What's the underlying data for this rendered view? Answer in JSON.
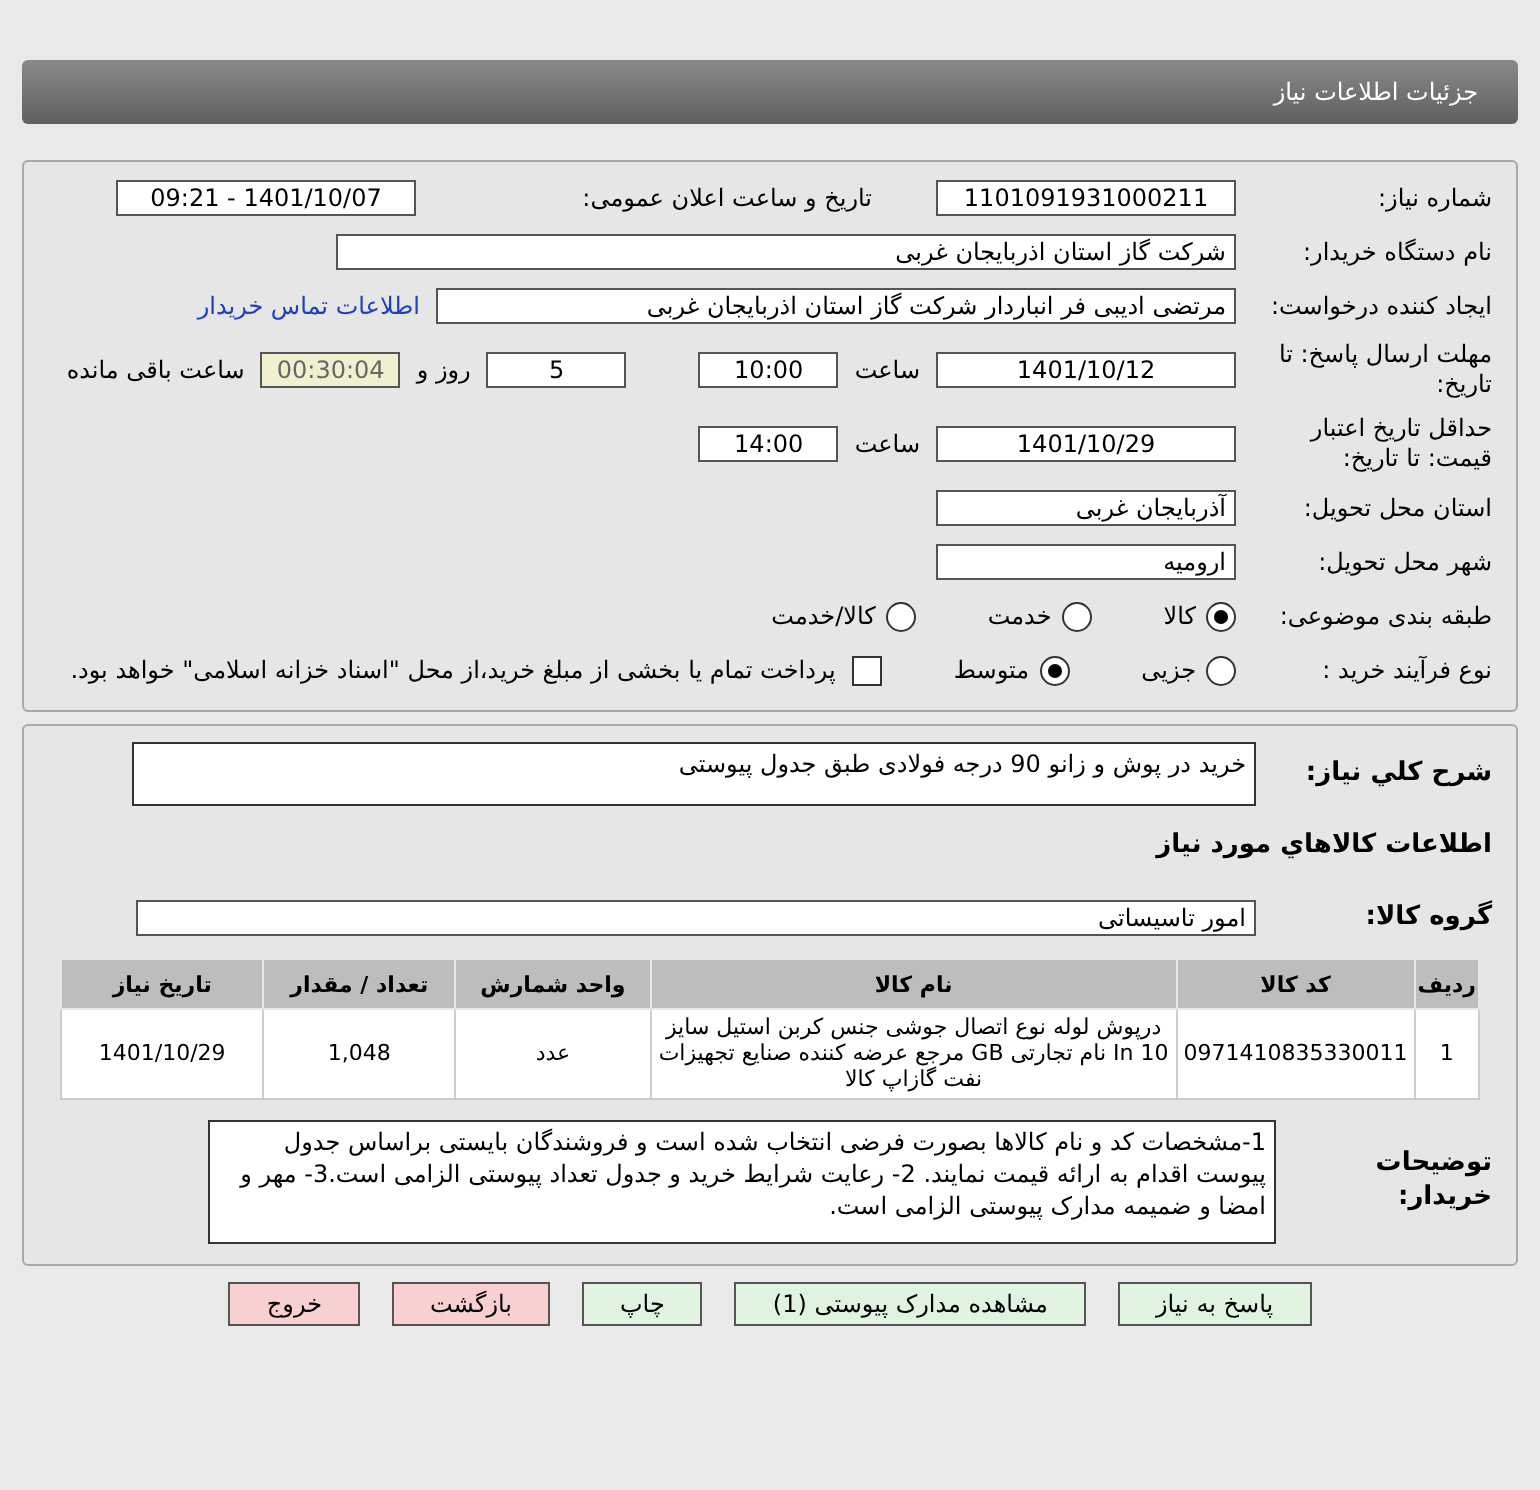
{
  "header": {
    "title": "جزئیات اطلاعات نیاز"
  },
  "details": {
    "need_number": {
      "label": "شماره نیاز:",
      "value": "1101091931000211"
    },
    "announce": {
      "label": "تاریخ و ساعت اعلان عمومی:",
      "value": "1401/10/07 - 09:21"
    },
    "buyer": {
      "label": "نام دستگاه خریدار:",
      "value": "شرکت گاز استان اذربایجان غربی"
    },
    "creator": {
      "label": "ایجاد کننده درخواست:",
      "value": "مرتضی ادیبی فر انباردار شرکت گاز استان اذربایجان غربی",
      "link": "اطلاعات تماس خریدار"
    },
    "deadline": {
      "label": "مهلت ارسال پاسخ: تا تاریخ:",
      "date": "1401/10/12",
      "time_label": "ساعت",
      "time": "10:00",
      "days": "5",
      "days_label": "روز و",
      "remaining": "00:30:04",
      "remaining_label": "ساعت باقی مانده"
    },
    "validity": {
      "label": "حداقل تاریخ اعتبار قیمت: تا تاریخ:",
      "date": "1401/10/29",
      "time_label": "ساعت",
      "time": "14:00"
    },
    "province": {
      "label": "استان محل تحویل:",
      "value": "آذربایجان غربی"
    },
    "city": {
      "label": "شهر محل تحویل:",
      "value": "ارومیه"
    },
    "category": {
      "label": "طبقه بندی موضوعی:",
      "options": [
        {
          "label": "کالا",
          "selected": true
        },
        {
          "label": "خدمت",
          "selected": false
        },
        {
          "label": "کالا/خدمت",
          "selected": false
        }
      ]
    },
    "process": {
      "label": "نوع فرآیند خرید :",
      "options": [
        {
          "label": "جزیی",
          "selected": false
        },
        {
          "label": "متوسط",
          "selected": true
        }
      ],
      "payment": {
        "checked": false,
        "text": "پرداخت تمام یا بخشی از مبلغ خرید،از محل \"اسناد خزانه اسلامی\" خواهد بود."
      }
    }
  },
  "summary": {
    "label": "شرح کلي نياز:",
    "value": "خرید در پوش و زانو 90 درجه فولادی طبق جدول پیوستی"
  },
  "goods": {
    "title": "اطلاعات کالاهاي مورد نياز",
    "group_label": "گروه کالا:",
    "group_value": "امور تاسیساتی",
    "columns": [
      "ردیف",
      "کد کالا",
      "نام کالا",
      "واحد شمارش",
      "تعداد / مقدار",
      "تاریخ نیاز"
    ],
    "rows": [
      {
        "index": "1",
        "code": "0971410835330011",
        "name": "درپوش لوله نوع اتصال جوشی جنس کربن استیل سایز 10 In نام تجارتی GB مرجع عرضه کننده صنایع تجهیزات نفت گازاپ کالا",
        "unit": "عدد",
        "quantity": "1,048",
        "date": "1401/10/29"
      }
    ]
  },
  "notes": {
    "label": "توضیحات خریدار:",
    "text": "1-مشخصات کد و نام کالاها بصورت فرضی انتخاب شده است و فروشندگان بایستی براساس جدول پیوست اقدام به ارائه قیمت نمایند. 2- رعایت شرایط خرید و جدول تعداد پیوستی الزامی است.3- مهر و امضا و ضمیمه مدارک پیوستی الزامی است."
  },
  "buttons": [
    {
      "label": "پاسخ به نیاز",
      "kind": "action"
    },
    {
      "label": "مشاهده مدارک پیوستی (1)",
      "kind": "action"
    },
    {
      "label": "چاپ",
      "kind": "action"
    },
    {
      "label": "بازگشت",
      "kind": "exit"
    },
    {
      "label": "خروج",
      "kind": "exit"
    }
  ]
}
